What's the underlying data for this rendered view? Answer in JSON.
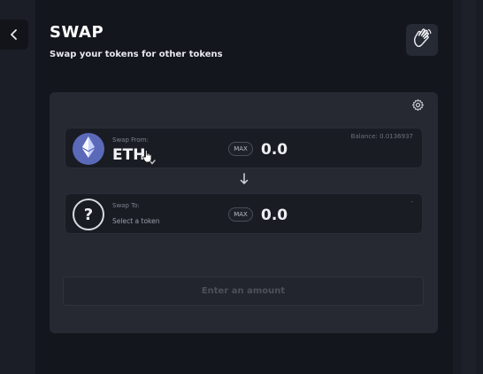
{
  "header": {
    "title": "SWAP",
    "subtitle": "Swap your tokens for other tokens"
  },
  "icons": {
    "back": "chevron-left-icon",
    "wave": "waving-hand-icon",
    "settings": "gear-icon",
    "arrow": "arrow-down-icon",
    "eth": "ethereum-icon",
    "question": "question-mark-icon"
  },
  "swap_from": {
    "label": "Swap From:",
    "token": "ETH",
    "max_label": "MAX",
    "amount": "0.0",
    "balance": "Balance: 0.0136937"
  },
  "swap_to": {
    "label": "Swap To:",
    "placeholder": "Select a token",
    "question_glyph": "?",
    "max_label": "MAX",
    "amount": "0.0",
    "balance": "-"
  },
  "action": {
    "label": "Enter an amount"
  },
  "colors": {
    "background": "#14161d",
    "card": "#262932",
    "row": "#1a1c24",
    "eth_icon": "#5b6ab8",
    "disabled_text": "#4c505b"
  }
}
